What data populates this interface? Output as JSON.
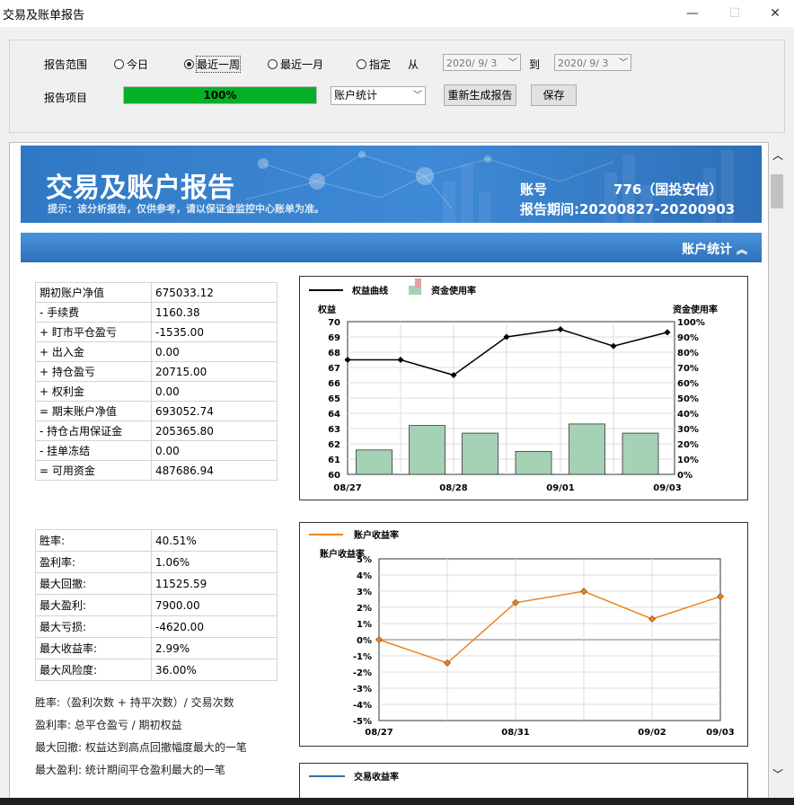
{
  "window": {
    "title": "交易及账单报告",
    "minimize": "—",
    "maximize": "☐",
    "close": "✕"
  },
  "controls": {
    "range_label": "报告范围",
    "item_label": "报告项目",
    "radios": [
      {
        "label": "今日",
        "checked": false
      },
      {
        "label": "最近一周",
        "checked": true
      },
      {
        "label": "最近一月",
        "checked": false
      },
      {
        "label": "指定",
        "checked": false
      }
    ],
    "from_label": "从",
    "to_label": "到",
    "date_from": "2020/ 9/ 3",
    "date_to": "2020/ 9/ 3",
    "progress": {
      "value": 100,
      "text": "100%"
    },
    "report_select": "账户统计",
    "regenerate_button": "重新生成报告",
    "save_button": "保存"
  },
  "banner": {
    "title": "交易及账户报告",
    "hint": "提示：该分析报告，仅供参考，请以保证金监控中心账单为准。",
    "account_label": "账号",
    "account_value": "776（国投安信）",
    "period": "报告期间:20200827-20200903"
  },
  "section": {
    "title": "账户统计",
    "collapse_icon": "double-chevron-up-icon"
  },
  "account_table": [
    [
      "期初账户净值",
      "675033.12"
    ],
    [
      "- 手续费",
      "1160.38"
    ],
    [
      "+ 盯市平仓盈亏",
      "-1535.00"
    ],
    [
      "+ 出入金",
      "0.00"
    ],
    [
      "+ 持仓盈亏",
      "20715.00"
    ],
    [
      "+ 权利金",
      "0.00"
    ],
    [
      "= 期末账户净值",
      "693052.74"
    ],
    [
      "- 持仓占用保证金",
      "205365.80"
    ],
    [
      "- 挂单冻结",
      "0.00"
    ],
    [
      "= 可用资金",
      "487686.94"
    ]
  ],
  "stats_table": [
    [
      "胜率:",
      "40.51%"
    ],
    [
      "盈利率:",
      "1.06%"
    ],
    [
      "最大回撤:",
      "11525.59"
    ],
    [
      "最大盈利:",
      "7900.00"
    ],
    [
      "最大亏损:",
      "-4620.00"
    ],
    [
      "最大收益率:",
      "2.99%"
    ],
    [
      "最大风险度:",
      "36.00%"
    ]
  ],
  "definitions": [
    "胜率:（盈利次数 + 持平次数）/ 交易次数",
    "盈利率: 总平仓盈亏 / 期初权益",
    "最大回撤: 权益达到高点回撤幅度最大的一笔",
    "最大盈利: 统计期间平仓盈利最大的一笔"
  ],
  "chart_data": [
    {
      "type": "bar+line",
      "legend": [
        "权益曲线",
        "资金使用率"
      ],
      "ylabel": "权益",
      "y2label": "资金使用率",
      "ylim": [
        60,
        70
      ],
      "yticks": [
        "60",
        "61",
        "62",
        "63",
        "64",
        "65",
        "66",
        "67",
        "68",
        "69",
        "70"
      ],
      "y2lim": [
        0,
        100
      ],
      "y2ticks": [
        "0%",
        "10%",
        "20%",
        "30%",
        "40%",
        "50%",
        "60%",
        "70%",
        "80%",
        "90%",
        "100%"
      ],
      "xticks": [
        "08/27",
        "08/28",
        "09/01",
        "09/03"
      ],
      "line_values": [
        67.5,
        67.5,
        66.5,
        69.0,
        69.5,
        68.4,
        69.3
      ],
      "bar_values": [
        16,
        32,
        27,
        15,
        33,
        27
      ],
      "line_color": "#000000",
      "bar_color": "#a5d1b4",
      "grid": true
    },
    {
      "type": "line",
      "legend": [
        "账户收益率"
      ],
      "ylabel": "账户收益率",
      "ylim": [
        -5,
        5
      ],
      "yticks": [
        "5%",
        "4%",
        "3%",
        "2%",
        "1%",
        "0%",
        "-1%",
        "-2%",
        "-3%",
        "-4%",
        "-5%"
      ],
      "xticks": [
        "08/27",
        "08/31",
        "09/02",
        "09/03"
      ],
      "values": [
        0.0,
        -1.44,
        2.29,
        2.99,
        1.28,
        2.67
      ],
      "line_color": "#f0821e",
      "grid": true
    },
    {
      "type": "line",
      "legend": [
        "交易收益率"
      ]
    }
  ]
}
